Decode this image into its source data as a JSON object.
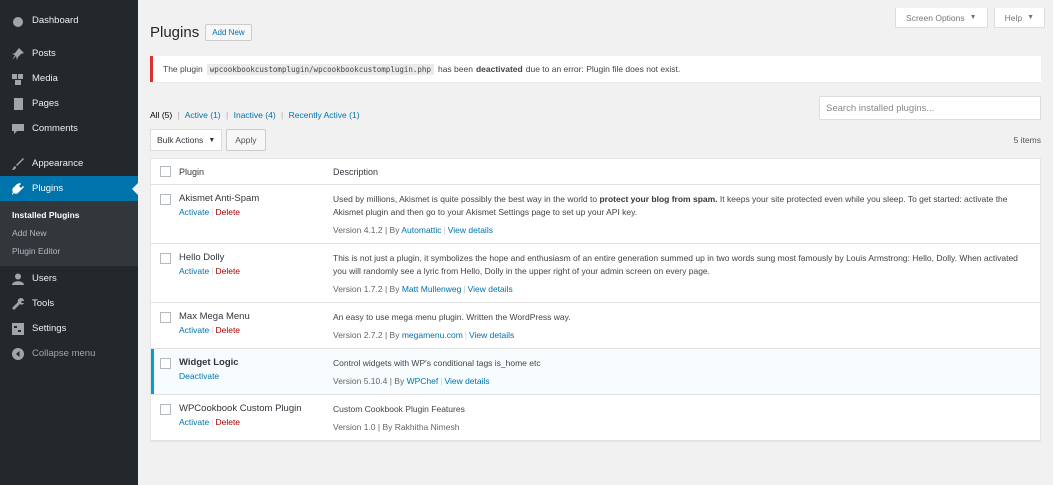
{
  "sidebar": {
    "items": [
      {
        "label": "Dashboard",
        "icon": "dashboard-icon"
      },
      {
        "label": "Posts",
        "icon": "pin-icon"
      },
      {
        "label": "Media",
        "icon": "media-icon"
      },
      {
        "label": "Pages",
        "icon": "page-icon"
      },
      {
        "label": "Comments",
        "icon": "comment-icon"
      },
      {
        "label": "Appearance",
        "icon": "brush-icon"
      },
      {
        "label": "Plugins",
        "icon": "plugin-icon"
      },
      {
        "label": "Users",
        "icon": "user-icon"
      },
      {
        "label": "Tools",
        "icon": "wrench-icon"
      },
      {
        "label": "Settings",
        "icon": "settings-icon"
      },
      {
        "label": "Collapse menu",
        "icon": "collapse-icon"
      }
    ],
    "submenu": [
      "Installed Plugins",
      "Add New",
      "Plugin Editor"
    ]
  },
  "header": {
    "screen_options": "Screen Options",
    "help": "Help",
    "title": "Plugins",
    "add_new": "Add New"
  },
  "notice": {
    "prefix": "The plugin",
    "code": "wpcookbookcustomplugin/wpcookbookcustomplugin.php",
    "middle": "has been",
    "bold": "deactivated",
    "suffix": "due to an error: Plugin file does not exist."
  },
  "filters": {
    "all": "All",
    "all_count": "(5)",
    "active": "Active",
    "active_count": "(1)",
    "inactive": "Inactive",
    "inactive_count": "(4)",
    "recent": "Recently Active",
    "recent_count": "(1)",
    "sep": "|"
  },
  "search": {
    "placeholder": "Search installed plugins..."
  },
  "bulk": {
    "select": "Bulk Actions",
    "apply": "Apply",
    "count": "5 items"
  },
  "table": {
    "headers": {
      "plugin": "Plugin",
      "description": "Description"
    },
    "rows": [
      {
        "name": "Akismet Anti-Spam",
        "action1": "Activate",
        "action2": "Delete",
        "desc_a": "Used by millions, Akismet is quite possibly the best way in the world to",
        "desc_bold": "protect your blog from spam.",
        "desc_b": "It keeps your site protected even while you sleep. To get started: activate the Akismet plugin and then go to your Akismet Settings page to set up your API key.",
        "version": "Version 4.1.2 | By",
        "author": "Automattic",
        "details": "View details"
      },
      {
        "name": "Hello Dolly",
        "action1": "Activate",
        "action2": "Delete",
        "desc_a": "This is not just a plugin, it symbolizes the hope and enthusiasm of an entire generation summed up in two words sung most famously by Louis Armstrong: Hello, Dolly. When activated you will randomly see a lyric from Hello, Dolly in the upper right of your admin screen on every page.",
        "version": "Version 1.7.2 | By",
        "author": "Matt Mullenweg",
        "details": "View details"
      },
      {
        "name": "Max Mega Menu",
        "action1": "Activate",
        "action2": "Delete",
        "desc_a": "An easy to use mega menu plugin. Written the WordPress way.",
        "version": "Version 2.7.2 | By",
        "author": "megamenu.com",
        "details": "View details"
      },
      {
        "name": "Widget Logic",
        "action1": "Deactivate",
        "desc_a": "Control widgets with WP's conditional tags is_home etc",
        "version": "Version 5.10.4 | By",
        "author": "WPChef",
        "details": "View details"
      },
      {
        "name": "WPCookbook Custom Plugin",
        "action1": "Activate",
        "action2": "Delete",
        "desc_a": "Custom Cookbook Plugin Features",
        "version": "Version 1.0 | By Rakhitha Nimesh"
      }
    ]
  },
  "colors": {
    "accent": "#0073aa",
    "sidebar": "#23282d",
    "error": "#dc3232",
    "active_border": "#00a0d2"
  }
}
